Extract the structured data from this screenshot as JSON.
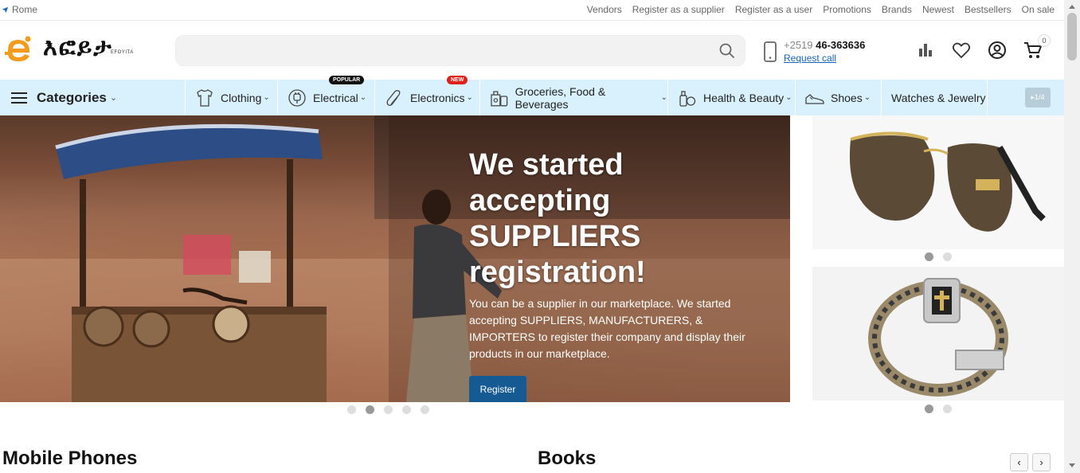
{
  "topbar": {
    "location": "Rome",
    "links": [
      "Vendors",
      "Register as a supplier",
      "Register as a user",
      "Promotions",
      "Brands",
      "Newest",
      "Bestsellers",
      "On sale"
    ]
  },
  "header": {
    "logo_text": "እፎይታ",
    "logo_sub": "EFOYITA",
    "search_placeholder": "",
    "phone_prefix": "+2519",
    "phone_main": "46-363636",
    "request_call": "Request call",
    "cart_count": "0"
  },
  "nav": {
    "categories_label": "Categories",
    "items": [
      {
        "label": "Clothing",
        "icon": "shirt-icon",
        "badge": ""
      },
      {
        "label": "Electrical",
        "icon": "plug-icon",
        "badge": "POPULAR"
      },
      {
        "label": "Electronics",
        "icon": "paperclip-icon",
        "badge": "NEW"
      },
      {
        "label": "Groceries, Food & Beverages",
        "icon": "grocery-icon",
        "badge": ""
      },
      {
        "label": "Health & Beauty",
        "icon": "cosmetics-icon",
        "badge": ""
      },
      {
        "label": "Shoes",
        "icon": "shoe-icon",
        "badge": ""
      },
      {
        "label": "Watches & Jewelry",
        "icon": "",
        "badge": ""
      }
    ],
    "pager": "1/4",
    "badge_colors": {
      "POPULAR": "#111111",
      "NEW": "#e0201b"
    }
  },
  "hero": {
    "title": "We started accepting SUPPLIERS registration!",
    "description": "You can be a supplier in our marketplace. We started accepting SUPPLIERS, MANUFACTURERS, & IMPORTERS to register their company and display their products in our marketplace.",
    "button": "Register",
    "slide_count": 5,
    "active_slide": 2
  },
  "side_banners": [
    {
      "subject": "sunglasses",
      "slide_count": 2,
      "active_slide": 1
    },
    {
      "subject": "bracelet",
      "slide_count": 2,
      "active_slide": 1
    }
  ],
  "sections": [
    {
      "title": "Mobile Phones"
    },
    {
      "title": "Books"
    }
  ],
  "colors": {
    "nav_bg": "#d9f0fd",
    "primary_button": "#165a94",
    "link": "#1565c0",
    "logo_orange": "#f29b1d"
  }
}
